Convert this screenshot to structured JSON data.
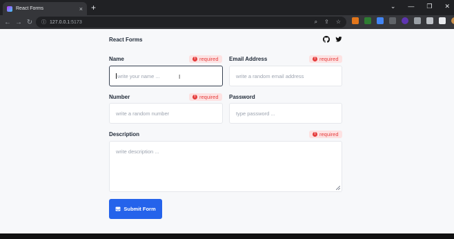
{
  "browser": {
    "tab_title": "React Forms",
    "url_host": "127.0.0.1",
    "url_port": ":5173",
    "new_tab_symbol": "+",
    "close_symbol": "×"
  },
  "header": {
    "brand": "React Forms",
    "icons": [
      "github-icon",
      "twitter-icon"
    ]
  },
  "form": {
    "name": {
      "label": "Name",
      "placeholder": "write your name ...",
      "badge": "required"
    },
    "email": {
      "label": "Email Address",
      "placeholder": "write a random email address",
      "badge": "required"
    },
    "number": {
      "label": "Number",
      "placeholder": "write a random number",
      "badge": "required"
    },
    "password": {
      "label": "Password",
      "placeholder": "type password ...",
      "badge": null
    },
    "description": {
      "label": "Description",
      "placeholder": "write description ...",
      "badge": "required"
    },
    "submit_label": "Submit Form"
  },
  "colors": {
    "accent": "#2563eb",
    "required_bg": "#fde2e2",
    "required_text": "#e53e3e"
  }
}
